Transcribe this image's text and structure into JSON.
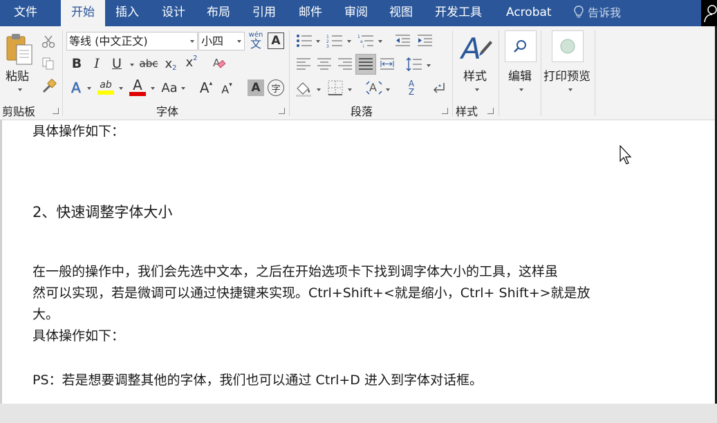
{
  "menu": {
    "tabs": [
      "文件",
      "开始",
      "插入",
      "设计",
      "布局",
      "引用",
      "邮件",
      "审阅",
      "视图",
      "开发工具",
      "Acrobat"
    ],
    "active_tab": "开始",
    "tell_me": "告诉我"
  },
  "ribbon": {
    "clipboard": {
      "paste": "粘贴",
      "group": "剪贴板"
    },
    "font": {
      "font_name": "等线 (中文正文)",
      "font_size": "小四",
      "phonetic_top": "wén",
      "phonetic_bottom": "文",
      "char_border": "A",
      "bold": "B",
      "italic": "I",
      "underline": "U",
      "strike": "abc",
      "sub": "x",
      "sub_mark": "2",
      "sup": "x",
      "sup_mark": "2",
      "text_effect": "A",
      "highlight": "ab",
      "font_color": "A",
      "change_case": "Aa",
      "grow": "A",
      "shrink": "A",
      "shading": "A",
      "enclose": "字",
      "group": "字体"
    },
    "paragraph": {
      "group": "段落",
      "sort_top": "A",
      "sort_bottom": "Z"
    },
    "styles": {
      "label": "样式",
      "group": "样式"
    },
    "editing": {
      "label": "编辑"
    },
    "print_preview": {
      "label": "打印预览"
    }
  },
  "document": {
    "lines": [
      "具体操作如下：",
      "2、快速调整字体大小",
      "在一般的操作中，我们会先选中文本，之后在开始选项卡下找到调字体大小的工具，这样虽",
      "然可以实现，若是微调可以通过快捷键来实现。Ctrl+Shift+<就是缩小，Ctrl+ Shift+>就是放",
      "大。",
      "具体操作如下：",
      "PS：若是想要调整其他的字体，我们也可以通过 Ctrl+D 进入到字体对话框。"
    ]
  },
  "colors": {
    "title_bar": "#2b579a",
    "ribbon_bg": "#f3f3f3",
    "highlight": "#ffff00",
    "font_color": "#e00000"
  }
}
